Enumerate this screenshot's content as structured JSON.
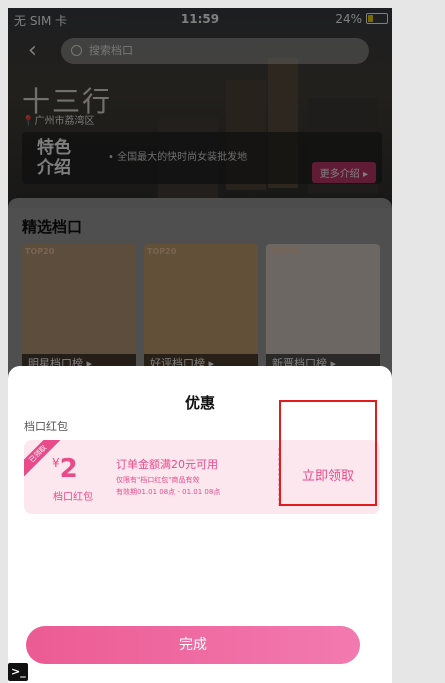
{
  "status_bar": {
    "carrier": "无 SIM 卡",
    "time": "11:59",
    "battery": "24%"
  },
  "nav": {
    "search_placeholder": "搜索档口"
  },
  "place": {
    "title": "十三行",
    "location": "广州市荔湾区"
  },
  "intro": {
    "badge_line1": "特色",
    "badge_line2": "介绍",
    "description": "• 全国最大的快时尚女装批发地",
    "more": "更多介绍 ▸"
  },
  "section": {
    "title": "精选档口"
  },
  "cards": [
    {
      "tag": "TOP20",
      "label": "明星档口榜 ▸",
      "color": "#b89a7a"
    },
    {
      "tag": "TOP20",
      "label": "好评档口榜 ▸",
      "color": "#c7a070"
    },
    {
      "tag": "TOP20",
      "label": "新晋档口榜 ▸",
      "color": "#d8cfc4"
    }
  ],
  "sheet": {
    "title": "优惠",
    "section_label": "档口红包",
    "coupon": {
      "corner": "已领取",
      "currency": "¥",
      "amount": "2",
      "kind": "档口红包",
      "condition": "订单金额满20元可用",
      "scope": "仅限有\"档口红包\"商品有效",
      "period": "有效期01.01 08点 - 01.01 08点",
      "claim": "立即领取"
    },
    "done": "完成"
  },
  "colors": {
    "accent": "#e94b8a",
    "highlight": "#e41b1b",
    "coupon_bg": "#fde7ee"
  },
  "icons": {
    "back": "chevron-left-icon",
    "search": "search-icon",
    "wifi": "wifi-icon",
    "terminal": "terminal-icon"
  }
}
